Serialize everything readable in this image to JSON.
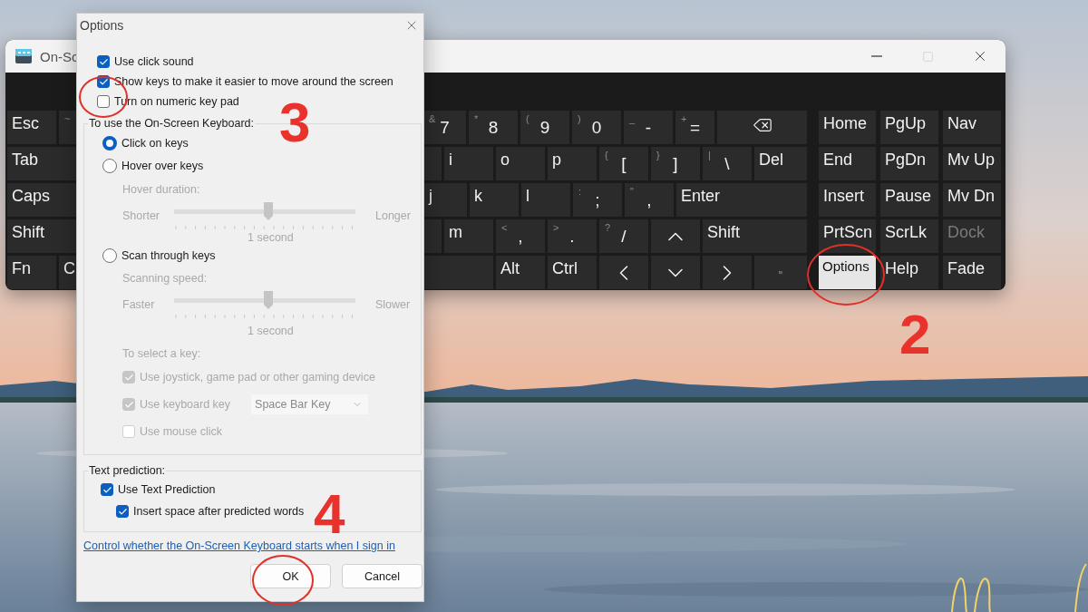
{
  "keyboard_window": {
    "title": "On-Sc",
    "left_keys": [
      [
        {
          "label": "Esc"
        },
        {
          "shift": "~"
        }
      ],
      [
        {
          "label": "Tab"
        }
      ],
      [
        {
          "label": "Caps"
        }
      ],
      [
        {
          "label": "Shift"
        }
      ],
      [
        {
          "label": "Fn"
        },
        {
          "label": "C"
        }
      ]
    ],
    "main_keys": [
      [
        {
          "label": "7",
          "shift": "&"
        },
        {
          "label": "8",
          "shift": "*"
        },
        {
          "label": "9",
          "shift": "("
        },
        {
          "label": "0",
          "shift": ")"
        },
        {
          "label": "-",
          "shift": "_"
        },
        {
          "label": "=",
          "shift": "+"
        },
        {
          "kind": "backspace"
        }
      ],
      [
        {
          "kind": "blank"
        },
        {
          "label": "i"
        },
        {
          "label": "o"
        },
        {
          "label": "p"
        },
        {
          "label": "[",
          "shift": "{"
        },
        {
          "label": "]",
          "shift": "}"
        },
        {
          "label": "\\",
          "shift": "|"
        },
        {
          "label": "Del"
        }
      ],
      [
        {
          "label": "j"
        },
        {
          "label": "k"
        },
        {
          "label": "l"
        },
        {
          "label": ";",
          "shift": ":"
        },
        {
          "label": ",",
          "shift": "\""
        },
        {
          "label": "Enter"
        }
      ],
      [
        {
          "kind": "blank"
        },
        {
          "label": "m"
        },
        {
          "label": ",",
          "shift": "<"
        },
        {
          "label": ".",
          "shift": ">"
        },
        {
          "label": "/",
          "shift": "?"
        },
        {
          "kind": "arrow-up"
        },
        {
          "label": "Shift"
        }
      ],
      [
        {
          "kind": "blank"
        },
        {
          "label": "Alt"
        },
        {
          "label": "Ctrl"
        },
        {
          "kind": "arrow-left"
        },
        {
          "kind": "arrow-down"
        },
        {
          "kind": "arrow-right"
        },
        {
          "kind": "menu"
        }
      ]
    ],
    "nav_keys": [
      [
        {
          "label": "Home",
          "disabled": false,
          "highlighted": false
        },
        {
          "label": "PgUp",
          "disabled": false,
          "highlighted": false
        },
        {
          "label": "Nav",
          "disabled": false,
          "highlighted": false
        }
      ],
      [
        {
          "label": "End",
          "disabled": false,
          "highlighted": false
        },
        {
          "label": "PgDn",
          "disabled": false,
          "highlighted": false
        },
        {
          "label": "Mv Up",
          "disabled": false,
          "highlighted": false
        }
      ],
      [
        {
          "label": "Insert",
          "disabled": false,
          "highlighted": false
        },
        {
          "label": "Pause",
          "disabled": false,
          "highlighted": false
        },
        {
          "label": "Mv Dn",
          "disabled": false,
          "highlighted": false
        }
      ],
      [
        {
          "label": "PrtScn",
          "disabled": false,
          "highlighted": false
        },
        {
          "label": "ScrLk",
          "disabled": false,
          "highlighted": false
        },
        {
          "label": "Dock",
          "disabled": true,
          "highlighted": false
        }
      ],
      [
        {
          "label": "Options",
          "disabled": false,
          "highlighted": true
        },
        {
          "label": "Help",
          "disabled": false,
          "highlighted": false
        },
        {
          "label": "Fade",
          "disabled": false,
          "highlighted": false
        }
      ]
    ]
  },
  "options_dialog": {
    "title": "Options",
    "checkboxes": [
      {
        "label": "Use click sound",
        "checked": true
      },
      {
        "label": "Show keys to make it easier to move around the screen",
        "checked": true
      },
      {
        "label": "Turn on numeric key pad",
        "checked": false
      }
    ],
    "input_group": {
      "legend": "To use the On-Screen Keyboard:",
      "modes": [
        {
          "label": "Click on keys",
          "selected": true
        },
        {
          "label": "Hover over keys",
          "selected": false
        },
        {
          "label": "Scan through keys",
          "selected": false
        }
      ],
      "hover": {
        "caption": "Hover duration:",
        "min_label": "Shorter",
        "max_label": "Longer",
        "level": 0.52,
        "reading": "1 second",
        "disabled": true
      },
      "scan": {
        "caption": "Scanning speed:",
        "min_label": "Faster",
        "max_label": "Slower",
        "level": 0.52,
        "reading": "1 second",
        "disabled": true
      },
      "select_group": {
        "caption": "To select a key:",
        "disabled": true,
        "options": [
          {
            "label": "Use joystick, game pad or other gaming device",
            "checked": true,
            "disabled": true
          },
          {
            "label": "Use keyboard key",
            "checked": true,
            "disabled": true
          },
          {
            "label": "Use mouse click",
            "checked": false,
            "disabled": true
          }
        ],
        "key_dropdown": {
          "value": "Space Bar Key",
          "disabled": true
        }
      }
    },
    "prediction_group": {
      "legend": "Text prediction:",
      "options": [
        {
          "label": "Use Text Prediction",
          "checked": true,
          "children": [
            {
              "label": "Insert space after predicted words",
              "checked": true
            }
          ]
        }
      ]
    },
    "link": "Control whether the On-Screen Keyboard starts when I sign in",
    "buttons": [
      {
        "label": "OK"
      },
      {
        "label": "Cancel"
      }
    ]
  },
  "annotations": [
    {
      "label": "3"
    },
    {
      "label": "2"
    },
    {
      "label": "4"
    }
  ]
}
